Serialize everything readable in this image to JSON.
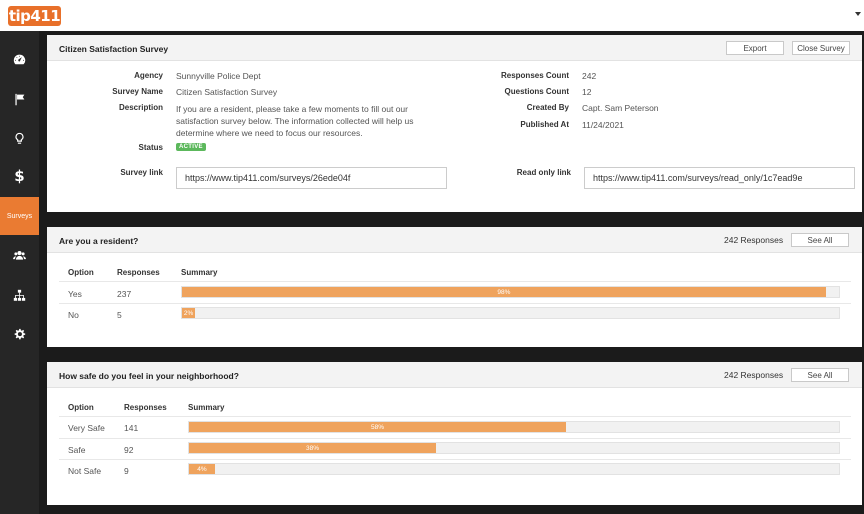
{
  "app": {
    "logo_text": "tip411"
  },
  "sidebar": {
    "items": [
      {
        "name": "dashboard",
        "icon": "speedometer-icon"
      },
      {
        "name": "flag",
        "icon": "flag-icon"
      },
      {
        "name": "tips",
        "icon": "lightbulb-icon"
      },
      {
        "name": "billing",
        "icon": "dollar-icon",
        "glyph": "$"
      },
      {
        "name": "surveys",
        "label": "Surveys",
        "active": true
      },
      {
        "name": "users",
        "icon": "users-icon"
      },
      {
        "name": "org",
        "icon": "sitemap-icon"
      },
      {
        "name": "settings",
        "icon": "gear-icon"
      }
    ]
  },
  "survey": {
    "title": "Citizen Satisfaction Survey",
    "export_label": "Export",
    "close_label": "Close Survey",
    "agency_label": "Agency",
    "agency": "Sunnyville Police Dept",
    "survey_name_label": "Survey Name",
    "survey_name": "Citizen Satisfaction Survey",
    "description_label": "Description",
    "description": "If you are a resident, please take a few moments to fill out our satisfaction survey below. The information collected will help us determine where we need to focus our resources.",
    "status_label": "Status",
    "status": "ACTIVE",
    "survey_link_label": "Survey link",
    "survey_link": "https://www.tip411.com/surveys/26ede04f",
    "responses_count_label": "Responses Count",
    "responses_count": "242",
    "questions_count_label": "Questions Count",
    "questions_count": "12",
    "created_by_label": "Created By",
    "created_by": "Capt. Sam Peterson",
    "published_at_label": "Published At",
    "published_at": "11/24/2021",
    "read_only_link_label": "Read only link",
    "read_only_link": "https://www.tip411.com/surveys/read_only/1c7ead9e"
  },
  "questions": [
    {
      "title": "Are you a resident?",
      "responses_label": "242 Responses",
      "see_all_label": "See All",
      "col_option": "Option",
      "col_responses": "Responses",
      "col_summary": "Summary",
      "rows": [
        {
          "option": "Yes",
          "responses": "237",
          "percent": 98,
          "percent_label": "98%"
        },
        {
          "option": "No",
          "responses": "5",
          "percent": 2,
          "percent_label": "2%"
        }
      ]
    },
    {
      "title": "How safe do you feel in your neighborhood?",
      "responses_label": "242 Responses",
      "see_all_label": "See All",
      "col_option": "Option",
      "col_responses": "Responses",
      "col_summary": "Summary",
      "rows": [
        {
          "option": "Very Safe",
          "responses": "141",
          "percent": 58,
          "percent_label": "58%"
        },
        {
          "option": "Safe",
          "responses": "92",
          "percent": 38,
          "percent_label": "38%"
        },
        {
          "option": "Not Safe",
          "responses": "9",
          "percent": 4,
          "percent_label": "4%"
        }
      ]
    }
  ],
  "colors": {
    "accent": "#ea7b32",
    "bar": "#efa35d",
    "status": "#5cb85c"
  }
}
